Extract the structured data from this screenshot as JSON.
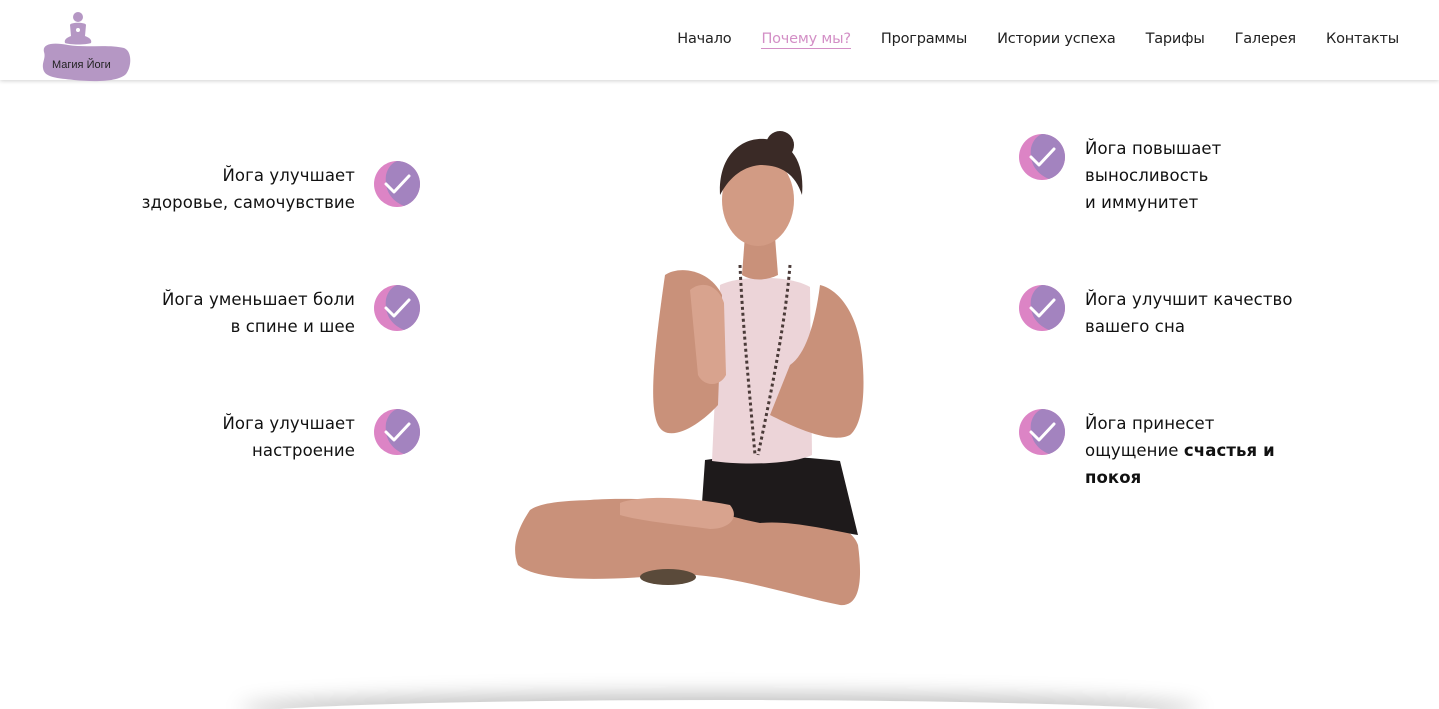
{
  "header": {
    "logo_text": "Магия Йоги",
    "nav": [
      {
        "label": "Начало",
        "active": false
      },
      {
        "label": "Почему мы?",
        "active": true
      },
      {
        "label": "Программы",
        "active": false
      },
      {
        "label": "Истории успеха",
        "active": false
      },
      {
        "label": "Тарифы",
        "active": false
      },
      {
        "label": "Галерея",
        "active": false
      },
      {
        "label": "Контакты",
        "active": false
      }
    ]
  },
  "features": {
    "left": [
      {
        "line1": "Йога улучшает",
        "line2": "здоровье, самочувствие"
      },
      {
        "line1": "Йога уменьшает боли",
        "line2": "в спине и шее"
      },
      {
        "line1": "Йога улучшает",
        "line2": "настроение"
      }
    ],
    "right": [
      {
        "line1": "Йога повышает",
        "line2": "выносливость",
        "line3": "и иммунитет"
      },
      {
        "line1": "Йога улучшит качество",
        "line2": "вашего сна"
      },
      {
        "line1": "Йога принесет",
        "line2_plain": "ощущение ",
        "line2_bold": "счастья и",
        "line3_bold": "покоя"
      }
    ]
  },
  "colors": {
    "accent": "#d38fc6",
    "check_purple": "#a383bf",
    "check_pink": "#dc84c5",
    "logo_blob": "#b597c4"
  }
}
